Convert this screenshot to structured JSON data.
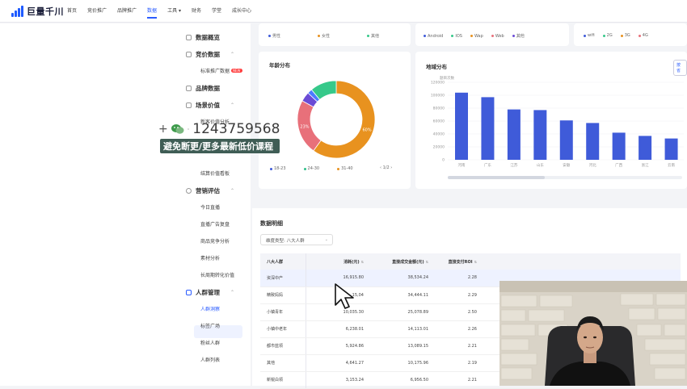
{
  "header": {
    "logo_text": "巨量千川",
    "nav": [
      "首页",
      "竞价推广",
      "品牌推广",
      "数据",
      "工具 ▾",
      "财务",
      "学堂",
      "成长中心"
    ],
    "active_nav": "数据"
  },
  "sidebar": {
    "groups": [
      {
        "label": "数据概览",
        "top": 0
      },
      {
        "label": "竞价数据"
      },
      {
        "label": "品牌数据"
      },
      {
        "label": "场景价值"
      },
      {
        "label": "营销评估"
      },
      {
        "label": "人群管理"
      }
    ],
    "items": {
      "bidding_ads": "标准推广数据",
      "scene_a": "新客价值分析",
      "scene_b": "结算价值看板",
      "eval_1": "今日直播",
      "eval_2": "直播广告复盘",
      "eval_3": "商品竞争分析",
      "eval_4": "素材分析",
      "eval_5": "长周期转化价值",
      "crowd_1": "人群洞察",
      "crowd_2": "标签广场",
      "crowd_3": "粉丝人群",
      "crowd_4": "人群列表"
    },
    "new_badge": "NEW"
  },
  "top_cards": {
    "gender_legend": [
      "男性",
      "女性",
      "其他"
    ],
    "platform_legend": [
      "Android",
      "IOS",
      "Wap",
      "Web",
      "其他"
    ],
    "network_legend": [
      "wifi",
      "2G",
      "3G",
      "4G"
    ]
  },
  "age_card": {
    "title": "年龄分布",
    "legend": [
      {
        "name": "18-23",
        "color": "#3f5bd9"
      },
      {
        "name": "24-30",
        "color": "#2fbf8a"
      },
      {
        "name": "31-40",
        "color": "#e8921f"
      }
    ],
    "pager": "‹ 1/2 ›",
    "chart_data": {
      "type": "pie",
      "slices": [
        {
          "label": "",
          "value": 60,
          "color": "#e8921f",
          "text": "60%"
        },
        {
          "label": "",
          "value": 23,
          "color": "#e8707a",
          "text": "23%"
        },
        {
          "label": "",
          "value": 4,
          "color": "#6b4bd6",
          "text": ""
        },
        {
          "label": "",
          "value": 2,
          "color": "#4a7bff",
          "text": ""
        },
        {
          "label": "",
          "value": 11,
          "color": "#36c98a",
          "text": ""
        }
      ]
    }
  },
  "region_card": {
    "title": "地域分布",
    "action_label": "按省",
    "y_unit": "题目次数",
    "chart_data": {
      "type": "bar",
      "categories": [
        "河南",
        "广东",
        "江苏",
        "山东",
        "安徽",
        "河北",
        "广西",
        "浙江",
        "云南"
      ],
      "values": [
        104000,
        97000,
        78000,
        77000,
        61000,
        57000,
        42000,
        37000,
        33000
      ],
      "yticks": [
        "0",
        "20000",
        "40000",
        "60000",
        "80000",
        "100000",
        "120000"
      ],
      "ylim": [
        0,
        120000
      ],
      "color": "#3f5bd9"
    }
  },
  "detail": {
    "title": "数据明细",
    "dimension_label": "维度类型:",
    "dimension_value": "八大人群",
    "columns": [
      "八大人群",
      "消耗(元)",
      "直接成交金额(元)",
      "直接支付ROI"
    ],
    "rows": [
      [
        "资深中产",
        "16,915.80",
        "38,534.24",
        "2.28"
      ],
      [
        "精致妈妈",
        "15,04",
        "34,444.11",
        "2.29"
      ],
      [
        "小镇青年",
        "10,035.30",
        "25,078.89",
        "2.50"
      ],
      [
        "小镇中老年",
        "6,238.01",
        "14,113.01",
        "2.26"
      ],
      [
        "都市蓝领",
        "5,924.86",
        "13,089.15",
        "2.21"
      ],
      [
        "其他",
        "4,641.27",
        "10,175.96",
        "2.19"
      ],
      [
        "新锐白领",
        "3,153.24",
        "6,956.50",
        "2.21"
      ]
    ]
  },
  "watermark": {
    "number": "1243759568",
    "slogan": "避免断更/更多最新低价课程"
  }
}
